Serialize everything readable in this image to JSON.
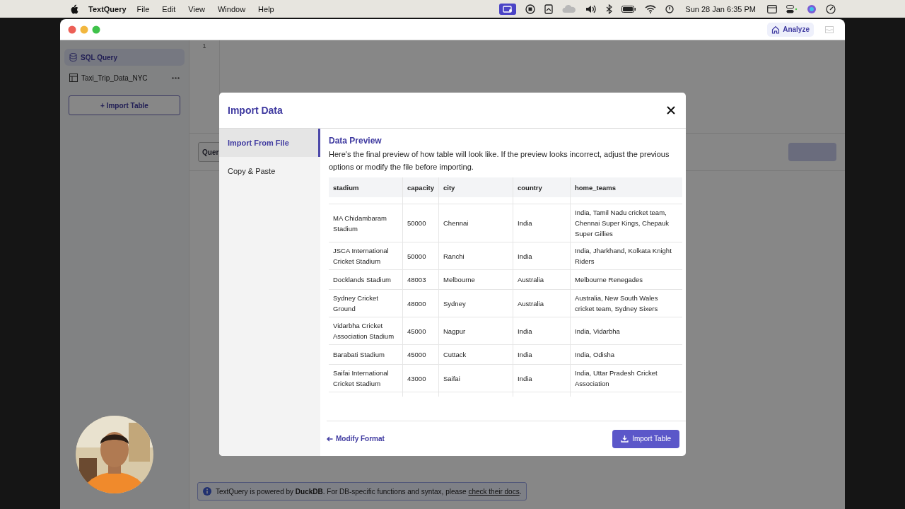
{
  "menu_bar": {
    "app_name": "TextQuery",
    "menus": [
      "File",
      "Edit",
      "View",
      "Window",
      "Help"
    ],
    "clock": "Sun 28 Jan  6:35 PM"
  },
  "toolbar": {
    "analyze_button": "Analyze"
  },
  "sidebar": {
    "items": [
      {
        "label": "SQL Query",
        "kind": "query",
        "selected": true
      },
      {
        "label": "Taxi_Trip_Data_NYC",
        "kind": "table",
        "selected": false
      }
    ],
    "import_button": "+ Import Table"
  },
  "editor": {
    "line_numbers": [
      "1"
    ]
  },
  "query_bar": {
    "tab_label": "Quer",
    "run_button": {
      "disabled": true
    }
  },
  "footer_note": {
    "text": "TextQuery is powered by **DuckDB**. For DB-specific functions and syntax, please ",
    "link": "check their docs",
    "text_after": "."
  },
  "dialog": {
    "title": "Import Data",
    "nav": [
      {
        "label": "Import From File",
        "selected": true
      },
      {
        "label": "Copy & Paste",
        "selected": false
      }
    ],
    "preview": {
      "title": "Data Preview",
      "description": "Here's the final preview of how table will look like. If the preview looks incorrect, adjust the previous options or modify the file before importing.",
      "columns": [
        "stadium",
        "capacity",
        "city",
        "country",
        "home_teams"
      ],
      "rows": [
        [
          "MA Chidambaram Stadium",
          "50000",
          "Chennai",
          "India",
          "India, Tamil Nadu cricket team, Chennai Super Kings, Chepauk Super Gillies"
        ],
        [
          "JSCA International Cricket Stadium",
          "50000",
          "Ranchi",
          "India",
          "India, Jharkhand, Kolkata Knight Riders"
        ],
        [
          "Docklands Stadium",
          "48003",
          "Melbourne",
          "Australia",
          "Melbourne Renegades"
        ],
        [
          "Sydney Cricket Ground",
          "48000",
          "Sydney",
          "Australia",
          "Australia, New South Wales cricket team, Sydney Sixers"
        ],
        [
          "Vidarbha Cricket Association Stadium",
          "45000",
          "Nagpur",
          "India",
          "India, Vidarbha"
        ],
        [
          "Barabati Stadium",
          "45000",
          "Cuttack",
          "India",
          "India, Odisha"
        ],
        [
          "Saifai International Cricket Stadium",
          "43000",
          "Saifai",
          "India",
          "India, Uttar Pradesh Cricket Association"
        ]
      ]
    },
    "back_link": "Modify Format",
    "primary_button": "Import Table"
  }
}
